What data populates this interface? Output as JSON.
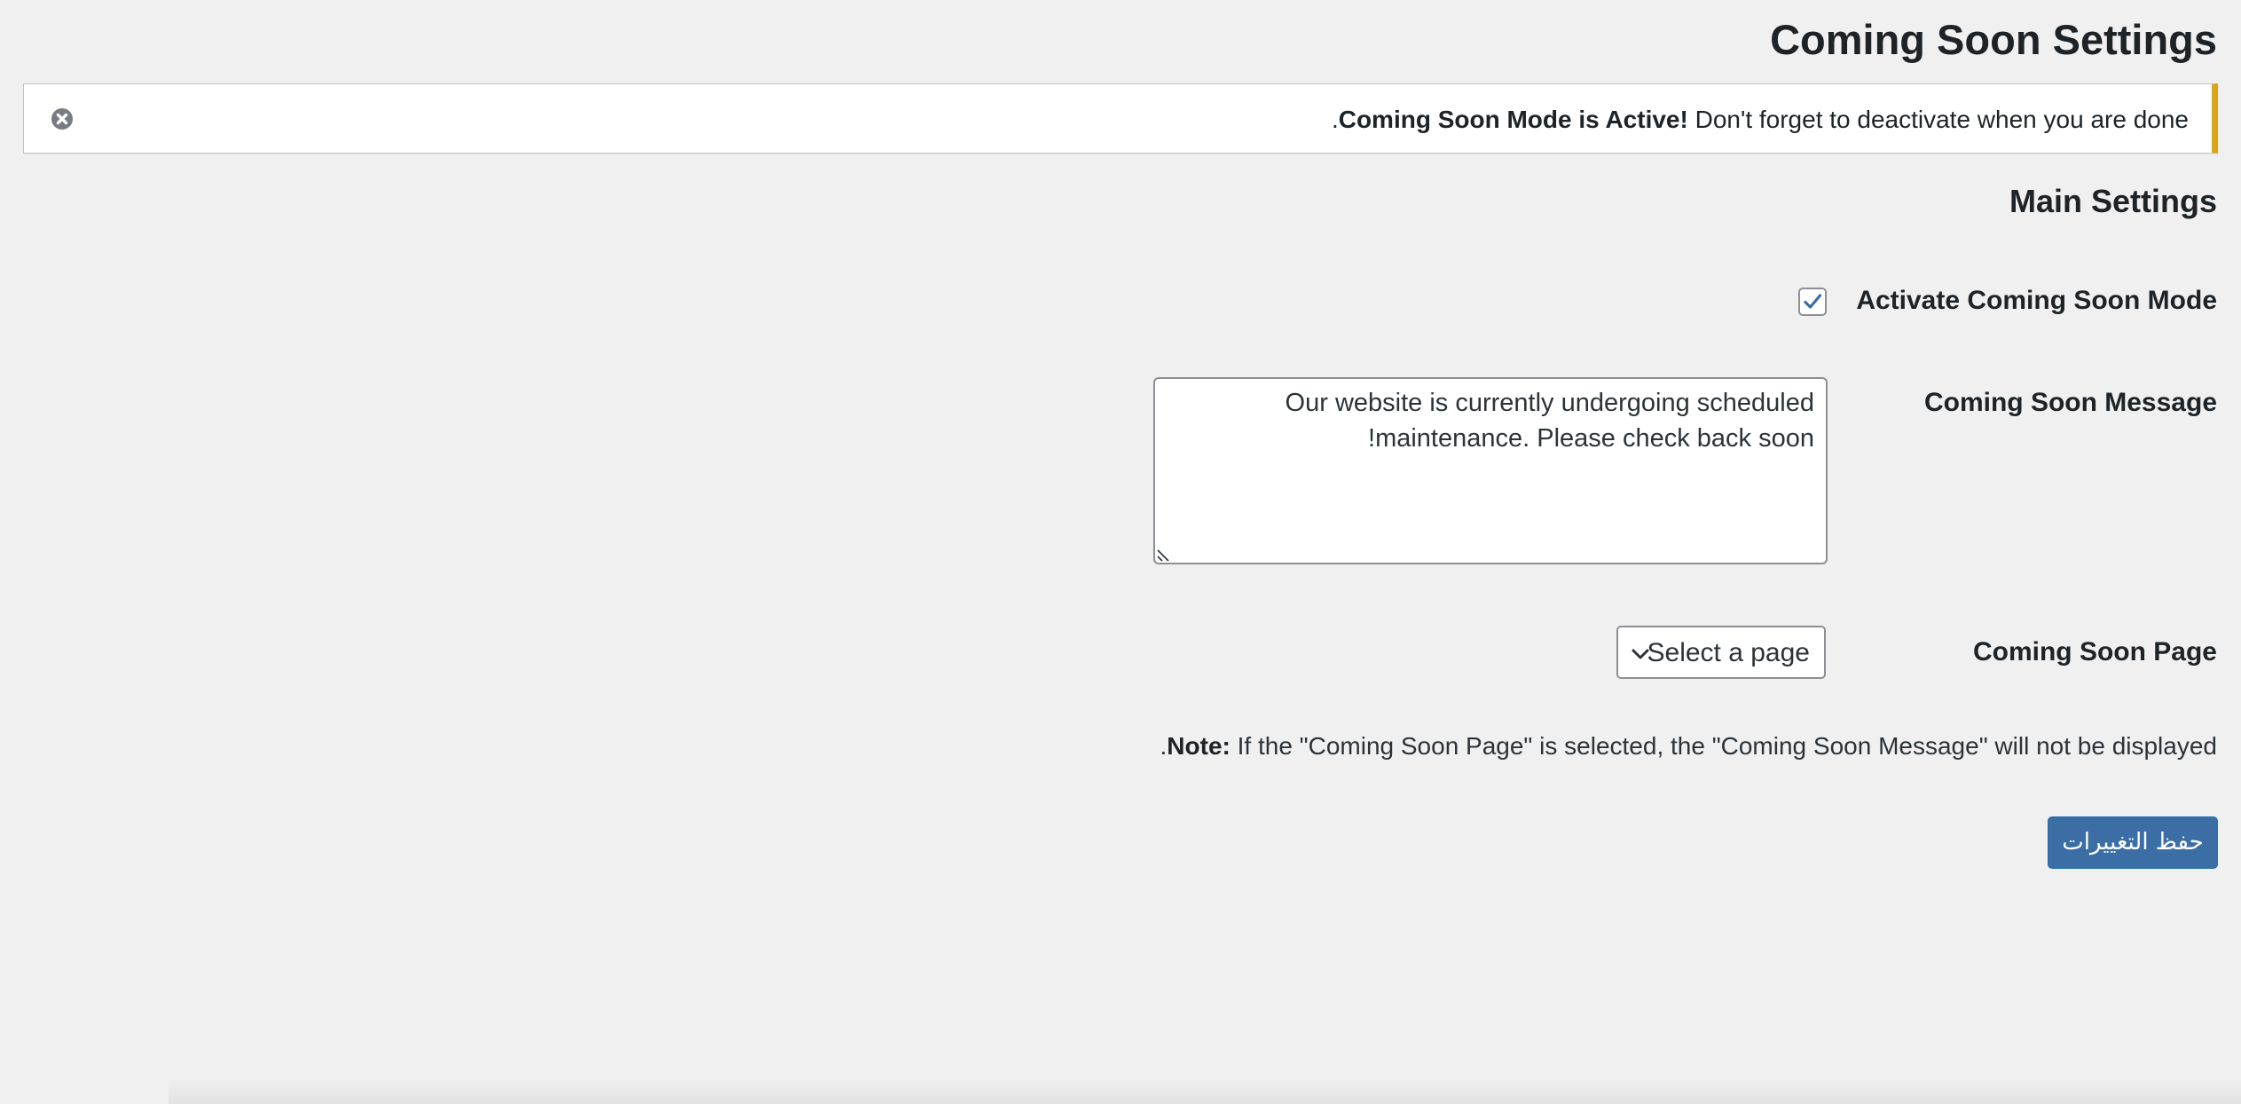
{
  "page": {
    "title": "Coming Soon Settings"
  },
  "notice": {
    "bold_text": "Coming Soon Mode is Active!",
    "text": "Don't forget to deactivate when you are done.",
    "dismiss_icon": "close-circle-icon",
    "accent_color": "#dba617"
  },
  "main_settings": {
    "title": "Main Settings",
    "activate": {
      "label": "Activate Coming Soon Mode",
      "checked": true,
      "check_color": "#3a6ea5"
    },
    "message": {
      "label": "Coming Soon Message",
      "value": "Our website is currently undergoing scheduled maintenance. Please check back soon!"
    },
    "page": {
      "label": "Coming Soon Page",
      "selected": "Select a page",
      "chevron_icon": "chevron-down-icon"
    },
    "note": {
      "bold": "Note:",
      "text": "If the \"Coming Soon Page\" is selected, the \"Coming Soon Message\" will not be displayed."
    }
  },
  "actions": {
    "save_label": "حفظ التغييرات",
    "save_color": "#3a6ea5"
  }
}
